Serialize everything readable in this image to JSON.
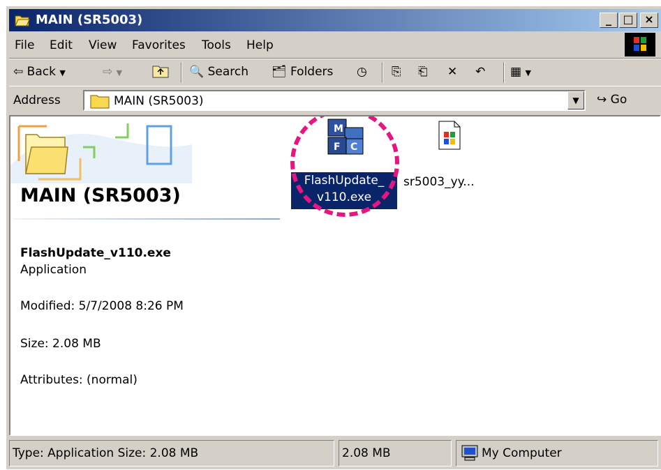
{
  "window": {
    "title": "MAIN (SR5003)"
  },
  "titlebar_buttons": {
    "minimize": "_",
    "maximize": "□",
    "close": "×"
  },
  "menu": [
    "File",
    "Edit",
    "View",
    "Favorites",
    "Tools",
    "Help"
  ],
  "toolbar": {
    "back": "Back",
    "search": "Search",
    "folders": "Folders"
  },
  "address": {
    "label": "Address",
    "value": "MAIN (SR5003)",
    "go": "Go"
  },
  "webview": {
    "title": "MAIN (SR5003)",
    "file_name": "FlashUpdate_v110.exe",
    "file_type": "Application",
    "modified": "Modified: 5/7/2008 8:26 PM",
    "size": "Size: 2.08 MB",
    "attributes": "Attributes: (normal)"
  },
  "files": [
    {
      "name_line1": "FlashUpdate_",
      "name_line2": "v110.exe",
      "selected": true,
      "icon": "mfc-app-icon"
    },
    {
      "name": "sr5003_yy...",
      "selected": false,
      "icon": "windows-file-icon"
    }
  ],
  "status": {
    "type_size": "Type: Application Size: 2.08 MB",
    "size": "2.08 MB",
    "zone": "My Computer"
  },
  "colors": {
    "titlebar_start": "#0a246a",
    "titlebar_end": "#a6caf0",
    "highlight": "#e7157f",
    "selection": "#0a246a"
  }
}
